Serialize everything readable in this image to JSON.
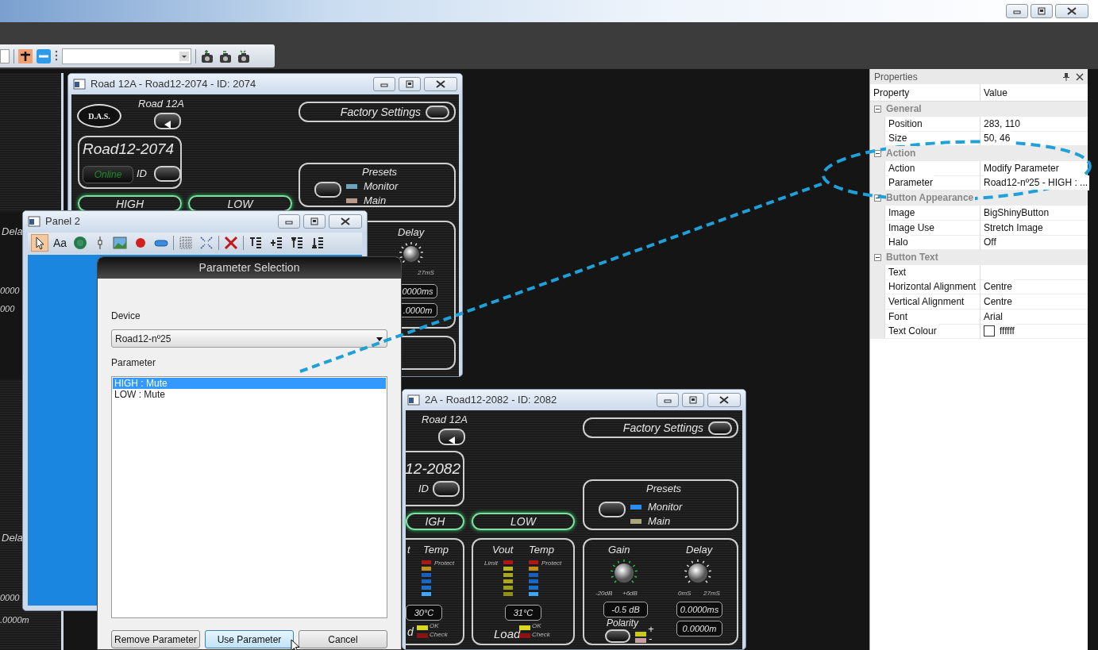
{
  "left_fragments": [
    {
      "text": "Dela",
      "kind": "label"
    },
    {
      "text": "0000",
      "kind": "readout"
    },
    {
      "text": "000",
      "kind": "readout"
    },
    {
      "text": "Dela",
      "kind": "label"
    },
    {
      "text": "0000",
      "kind": "readout"
    },
    {
      "text": ".0000m",
      "kind": "readout"
    }
  ],
  "device_windows": [
    {
      "title": "Road 12A - Road12-2074 - ID: 2074",
      "logo": "D.A.S.",
      "model": "Road 12A",
      "device_name": "Road12-2074",
      "status": "Online",
      "id_label": "ID",
      "factory_button": "Factory Settings",
      "presets": {
        "title": "Presets",
        "items": [
          {
            "label": "Monitor",
            "color": "#6fa3bd"
          },
          {
            "label": "Main",
            "color": "#b89a8a"
          }
        ]
      },
      "bands": [
        {
          "label": "HIGH",
          "on": true
        },
        {
          "label": "LOW",
          "on": true
        }
      ],
      "delay": {
        "title": "Delay",
        "max": "27mS",
        "time": "0000ms",
        "distance": ".0000m"
      }
    },
    {
      "title": "2A - Road12-2082 - ID: 2082",
      "model": "Road 12A",
      "device_name": "12-2082",
      "id_label": "ID",
      "factory_button": "Factory Settings",
      "presets": {
        "title": "Presets",
        "items": [
          {
            "label": "Monitor",
            "color": "#2a8cf0"
          },
          {
            "label": "Main",
            "color": "#a8a878"
          }
        ]
      },
      "bands": [
        {
          "label": "IGH",
          "on": true
        },
        {
          "label": "LOW",
          "on": true
        }
      ],
      "temp_panels": [
        {
          "vout": "t",
          "temp": "Temp",
          "protect": "Protect",
          "reading": "30°C",
          "load": "d",
          "ok": "OK",
          "check": "Check"
        },
        {
          "vout": "Vout",
          "temp": "Temp",
          "limit": "Limit",
          "protect": "Protect",
          "reading": "31°C",
          "load": "Load",
          "ok": "OK",
          "check": "Check"
        }
      ],
      "gain_delay": {
        "gain": "Gain",
        "delay": "Delay",
        "gain_min": "-20dB",
        "gain_max": "+6dB",
        "delay_min": "0mS",
        "delay_max": "27mS",
        "gain_value": "-0.5 dB",
        "delay_time": "0.0000ms",
        "delay_distance": "0.0000m",
        "polarity": "Polarity",
        "plus": "+",
        "minus": "-"
      }
    }
  ],
  "panel_window": {
    "title": "Panel 2",
    "tools": [
      {
        "kind": "pointer",
        "selected": true
      },
      {
        "kind": "text",
        "label": "Aa",
        "selected": false
      },
      {
        "kind": "knob",
        "selected": false
      },
      {
        "kind": "slider",
        "selected": false
      },
      {
        "kind": "image",
        "selected": false
      },
      {
        "kind": "led",
        "selected": false
      },
      {
        "kind": "switch",
        "selected": false
      },
      {
        "kind": "separator"
      },
      {
        "kind": "grid",
        "selected": false
      },
      {
        "kind": "fit",
        "selected": false
      },
      {
        "kind": "separator"
      },
      {
        "kind": "delete",
        "selected": false
      },
      {
        "kind": "separator"
      },
      {
        "kind": "align-top",
        "selected": false
      },
      {
        "kind": "align-middle",
        "selected": false
      },
      {
        "kind": "align-up",
        "selected": false
      },
      {
        "kind": "align-bottom",
        "selected": false
      }
    ]
  },
  "parameter_dialog": {
    "title": "Parameter Selection",
    "device_label": "Device",
    "device": "Road12-nº25",
    "parameter_label": "Parameter",
    "parameters": [
      {
        "label": "HIGH : Mute",
        "selected": true
      },
      {
        "label": "LOW : Mute",
        "selected": false
      }
    ],
    "buttons": [
      {
        "label": "Remove Parameter",
        "hovered": false
      },
      {
        "label": "Use Parameter",
        "hovered": true
      },
      {
        "label": "Cancel",
        "hovered": false
      }
    ]
  },
  "properties": {
    "title": "Properties",
    "columns": [
      "Property",
      "Value"
    ],
    "groups": [
      {
        "name": "General",
        "expanded": true,
        "rows": [
          {
            "property": "Position",
            "value": "283, 110"
          },
          {
            "property": "Size",
            "value": "50, 46"
          }
        ]
      },
      {
        "name": "Action",
        "expanded": true,
        "rows": [
          {
            "property": "Action",
            "value": "Modify Parameter"
          },
          {
            "property": "Parameter",
            "value": "Road12-nº25 - HIGH : ..."
          }
        ]
      },
      {
        "name": "Button Appearance",
        "expanded": true,
        "rows": [
          {
            "property": "Image",
            "value": "BigShinyButton"
          },
          {
            "property": "Image Use",
            "value": "Stretch Image"
          },
          {
            "property": "Halo",
            "value": "Off"
          }
        ]
      },
      {
        "name": "Button Text",
        "expanded": true,
        "rows": [
          {
            "property": "Text"
          },
          {
            "property": "Horizontal Alignment",
            "value": "Centre"
          },
          {
            "property": "Vertical Alignment",
            "value": "Centre"
          },
          {
            "property": "Font",
            "value": "Arial"
          },
          {
            "property": "Text Colour",
            "value": "ffffff",
            "color": "#ffffff"
          }
        ]
      }
    ]
  }
}
